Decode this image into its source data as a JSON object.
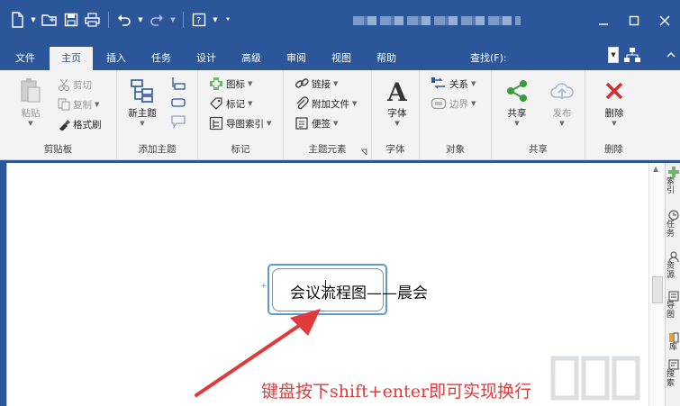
{
  "ribbon_tabs": [
    "文件",
    "主页",
    "插入",
    "任务",
    "设计",
    "高级",
    "审阅",
    "视图",
    "帮助"
  ],
  "find_label": "查找(F):",
  "groups": {
    "clipboard": {
      "label": "剪贴板",
      "paste": "粘贴",
      "cut": "剪切",
      "copy": "复制",
      "format_painter": "格式刷"
    },
    "add_topic": {
      "label": "添加主题",
      "new_topic": "新主题"
    },
    "markers": {
      "label": "标记",
      "icon": "图标",
      "tag": "标记",
      "map_index": "导图索引"
    },
    "topic_elements": {
      "label": "主题元素",
      "link": "链接",
      "attach_file": "附加文件",
      "note": "便签"
    },
    "font": {
      "label": "字体",
      "font": "字体"
    },
    "object": {
      "label": "对象",
      "relation": "关系",
      "boundary": "边界"
    },
    "share": {
      "label": "共享",
      "share": "共享",
      "publish": "发布"
    },
    "delete": {
      "label": "删除",
      "delete": "删除"
    }
  },
  "side_panel": [
    "索引",
    "任务",
    "资源",
    "导图",
    "库",
    "搜索"
  ],
  "topic_text": "会议流程图——晨会",
  "annotation": "键盘按下shift+enter即可实现换行",
  "colors": {
    "brand": "#2b579a",
    "annotation": "#e03a3a",
    "selection": "#5b9bd5",
    "delete_icon": "#d32f2f",
    "share_icon": "#3c9a3c"
  }
}
